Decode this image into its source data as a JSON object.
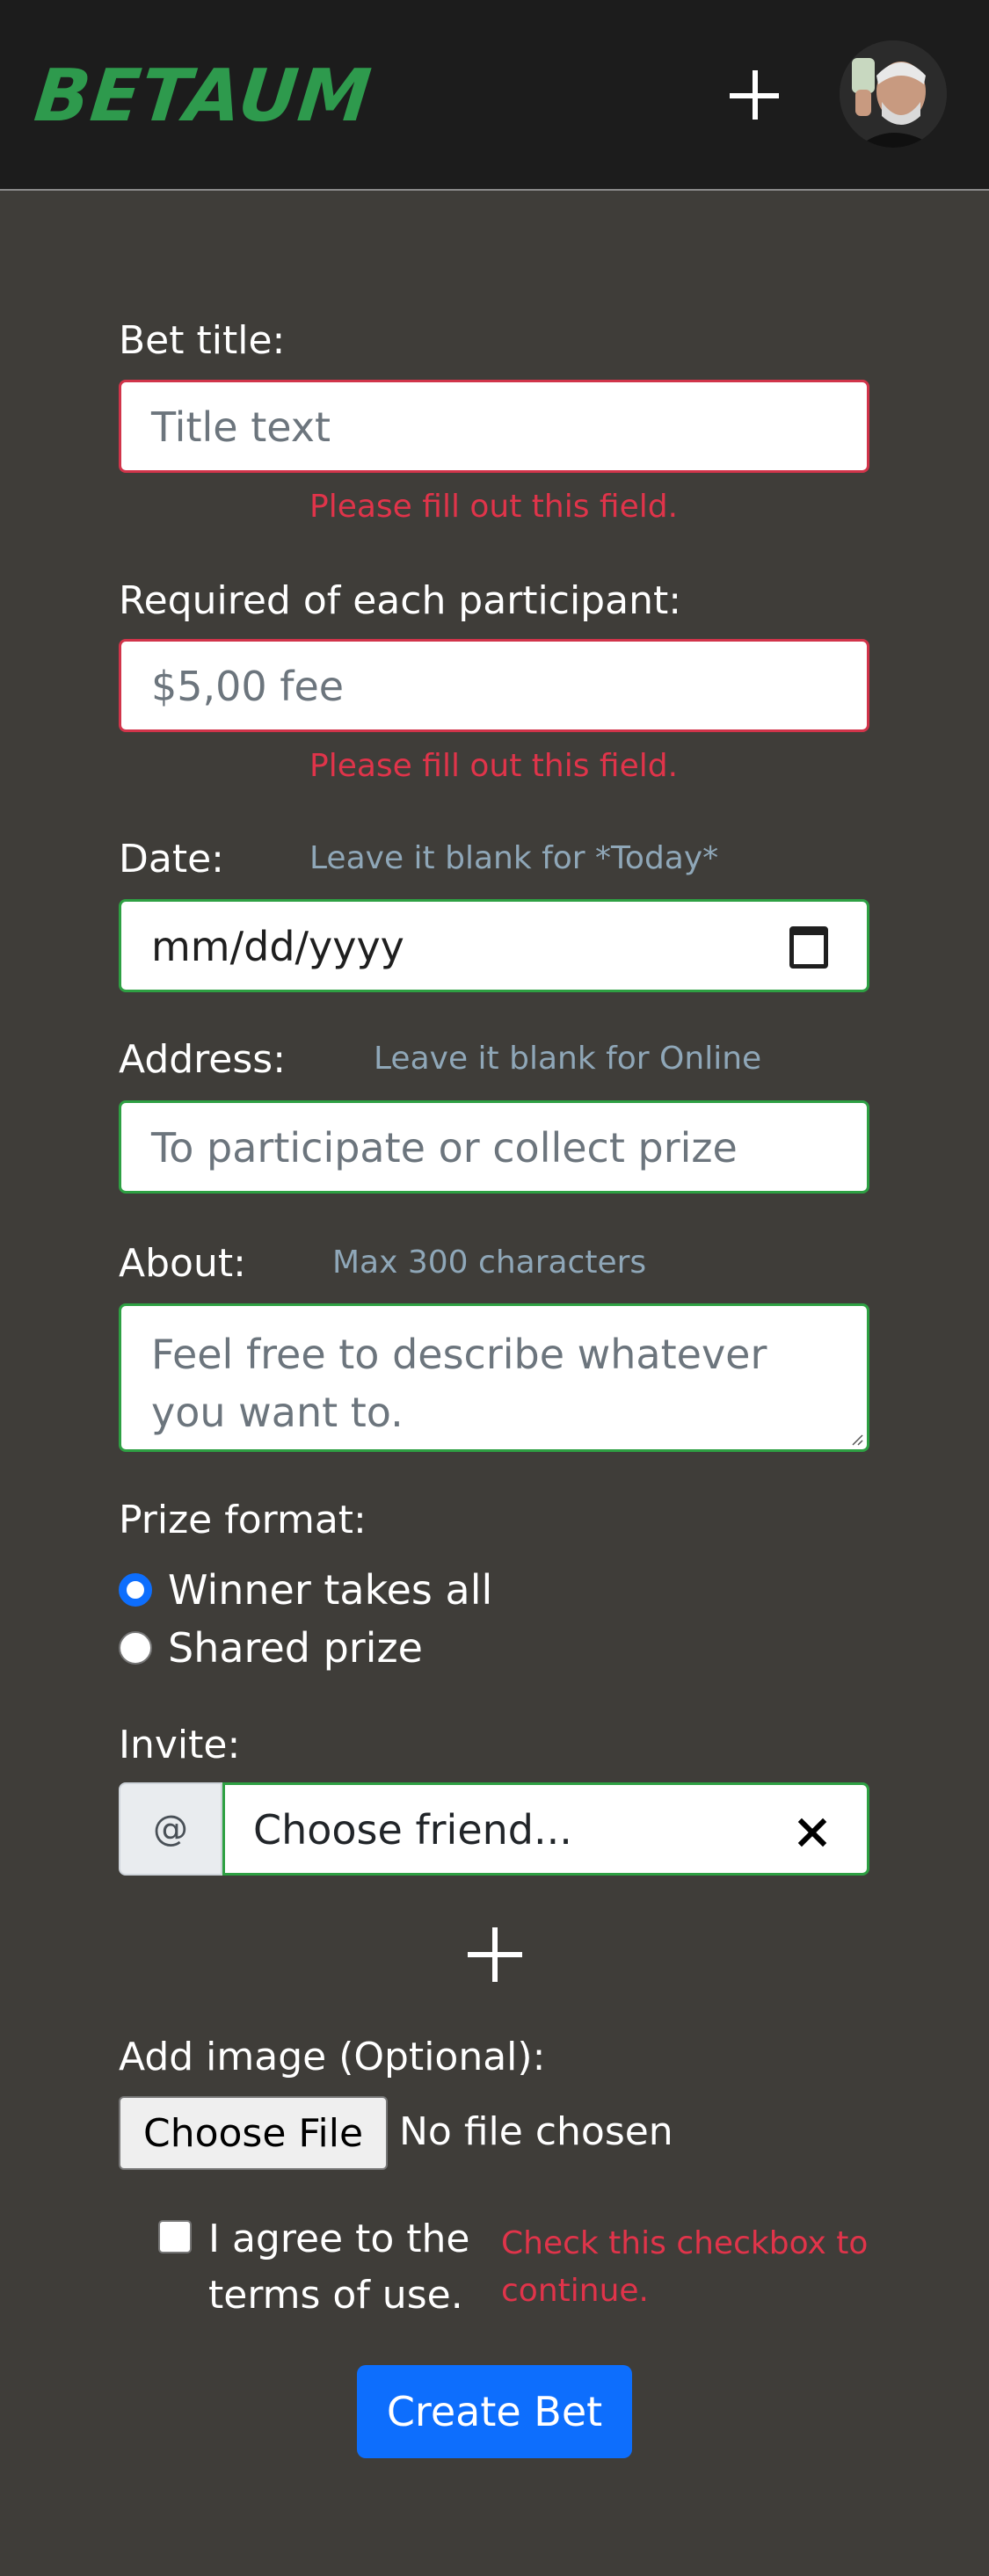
{
  "navbar": {
    "brand": "BETAUM",
    "add_icon": "plus-icon",
    "avatar": "user-avatar"
  },
  "form": {
    "title": {
      "label": "Bet title:",
      "placeholder": "Title text",
      "error": "Please fill out this field."
    },
    "requirement": {
      "label": "Required of each participant:",
      "placeholder": "$5,00 fee",
      "error": "Please fill out this field."
    },
    "date": {
      "label": "Date:",
      "hint": "Leave it blank for *Today*",
      "placeholder": "mm/dd/yyyy",
      "icon": "calendar-icon"
    },
    "address": {
      "label": "Address:",
      "hint": "Leave it blank for Online",
      "placeholder": "To participate or collect prize"
    },
    "about": {
      "label": "About:",
      "hint": "Max 300 characters",
      "placeholder": "Feel free to describe whatever you want to."
    },
    "prize": {
      "label": "Prize format:",
      "options": [
        "Winner takes all",
        "Shared prize"
      ],
      "selected": "Winner takes all"
    },
    "invite": {
      "label": "Invite:",
      "addon": "@",
      "value": "Choose friend...",
      "clear_icon": "close-icon",
      "add_icon": "plus-icon"
    },
    "image": {
      "label": "Add image (Optional):",
      "button": "Choose File",
      "status": "No file chosen"
    },
    "terms": {
      "label": "I agree to the terms of use.",
      "error": "Check this checkbox to continue."
    },
    "submit": "Create Bet"
  },
  "colors": {
    "background": "#3f3d39",
    "navbar": "#1c1c1c",
    "brand": "#2e9a4d",
    "valid": "#2ea043",
    "invalid": "#d1344a",
    "error_text": "#e0344a",
    "hint_text": "#8fa7b8",
    "primary": "#0d6efd"
  }
}
